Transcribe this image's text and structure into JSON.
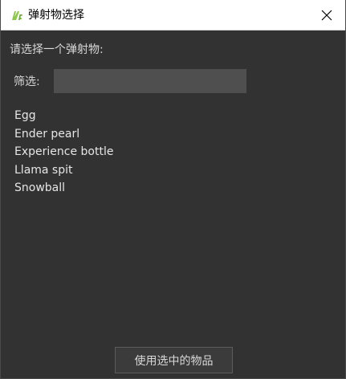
{
  "window": {
    "title": "弹射物选择",
    "app_icon": "mcreator-logo-icon",
    "close_icon": "close-icon"
  },
  "dialog": {
    "prompt": "请选择一个弹射物:",
    "filter_label": "筛选:",
    "filter_value": "",
    "items": [
      "Egg",
      "Ender pearl",
      "Experience bottle",
      "Llama spit",
      "Snowball"
    ],
    "use_button_label": "使用选中的物品"
  },
  "colors": {
    "background": "#323232",
    "titlebar": "#ffffff",
    "input_bg": "#4f4f4f",
    "text": "#e6e6e6",
    "logo_green": "#8cc84b"
  }
}
